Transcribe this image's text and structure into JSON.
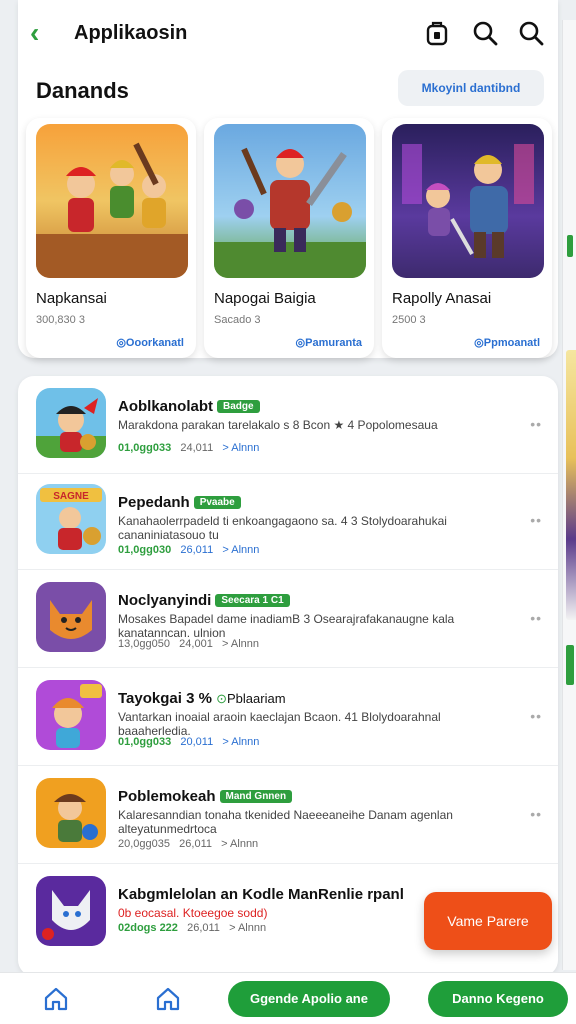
{
  "header": {
    "title": "Applikaosin",
    "back_icon": "chevron-left-icon",
    "icons": [
      "bag-icon",
      "search-icon",
      "search-icon"
    ]
  },
  "featured": {
    "title": "Danands",
    "see_more": "Mkoyinl dantibnd",
    "items": [
      {
        "name": "Napkansai",
        "meta": "300,830 3",
        "link": "Ooorkanatl"
      },
      {
        "name": "Napogai Baigia",
        "meta": "Sacado 3",
        "link": "Pamuranta"
      },
      {
        "name": "Rapolly Anasai",
        "meta": "2500 3",
        "link": "Ppmoanatl"
      }
    ]
  },
  "apps": [
    {
      "name": "Aoblkanolabt",
      "badge": "Badge",
      "desc": "Marakdona parakan tarelakalo s 8 Bcon ★ 4 Popolomesaua",
      "downloads": "01,0gg033",
      "size": "24,011",
      "extra": "> Alnnn"
    },
    {
      "name": "Pepedanh",
      "badge": "Pvaabe",
      "desc": "Kanahaolerrpadeld ti enkoangagaono sa. 4 3 Stolydoarahukai cananiniatasouo tu",
      "downloads": "01,0gg030",
      "size": "26,011",
      "extra": "> Alnnn"
    },
    {
      "name": "Noclyanyindi",
      "badge": "Seecara 1 C1",
      "desc": "Mosakes Bapadel dame inadiamB 3 Osearajrafakanaugne kala kanatanncan. ulnion",
      "downloads": "13,0gg050",
      "size": "24,001",
      "extra": "> Alnnn"
    },
    {
      "name": "Tayokgai 3 %",
      "badge": "Pblaariam",
      "desc": "Vantarkan inoaial araoin kaeclajan Bcaon. 41 Blolydoarahnal baaaherledia.",
      "downloads": "01,0gg033",
      "size": "20,011",
      "extra": "> Alnnn"
    },
    {
      "name": "Poblemokeah",
      "badge": "Mand Gnnen",
      "desc": "Kalaresanndian tonaha tkenided Naeeeaneihe Danam agenlan alteyatunmedrtoca",
      "downloads": "20,0gg035",
      "size": "26,011",
      "extra": "> Alnnn"
    },
    {
      "name": "Kabgmlelolan an Kodle ManRenlie rpanl",
      "badge": "",
      "desc": "0b eocasal. Ktoeegoe sodd)",
      "downloads": "02dogs 222",
      "size": "26,011",
      "extra": "> Alnnn"
    }
  ],
  "fab": {
    "label": "Vame Parere"
  },
  "bottom_bar": {
    "home_icon": "home-icon",
    "primary_btn": "Ggende Apolio ane",
    "secondary_btn": "Danno Kegeno"
  },
  "colors": {
    "accent_green": "#2e9e3e",
    "link_blue": "#2a6fd1",
    "fab_orange": "#ee4f18"
  }
}
